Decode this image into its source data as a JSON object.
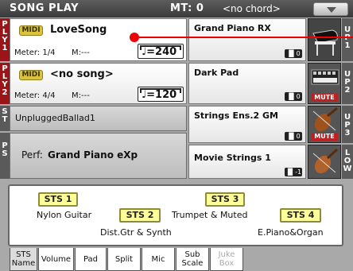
{
  "header": {
    "title": "SONG PLAY",
    "mt": "MT: 0",
    "chord": "<no chord>",
    "dropdown_icon": "triangle-down-icon"
  },
  "players": [
    {
      "tab": [
        "P",
        "L",
        "Y",
        "1"
      ],
      "midi": "MIDI",
      "song": "LoveSong",
      "meter": "Meter: 1/4",
      "measure": "M:---",
      "tempo": "♩=240"
    },
    {
      "tab": [
        "P",
        "L",
        "Y",
        "2"
      ],
      "midi": "MIDI",
      "song": "<no song>",
      "meter": "Meter: 4/4",
      "measure": "M:---",
      "tempo": "♩=120"
    }
  ],
  "st": {
    "tab": [
      "S",
      "T"
    ],
    "label": "UnpluggedBallad1"
  },
  "ps": {
    "tab": [
      "P",
      "S"
    ],
    "label": "Perf:",
    "perf": "Grand Piano eXp"
  },
  "sounds": [
    {
      "name": "Grand Piano RX",
      "badge": "▐▌0",
      "icon": "grand-piano-icon",
      "muted": false,
      "side": [
        "U",
        "P",
        "1"
      ]
    },
    {
      "name": "Dark Pad",
      "badge": "▐▌0",
      "icon": "synth-keyboard-icon",
      "muted": true,
      "mute_label": "MUTE",
      "side": [
        "U",
        "P",
        "2"
      ]
    },
    {
      "name": "Strings Ens.2 GM",
      "badge": "▐▌0",
      "icon": "violin-icon",
      "muted": true,
      "mute_label": "MUTE",
      "side": [
        "U",
        "P",
        "3"
      ]
    },
    {
      "name": "Movie Strings 1",
      "badge": "▐▌-1",
      "icon": "violin-icon",
      "muted": false,
      "side": [
        "L",
        "O",
        "W"
      ]
    }
  ],
  "sts": {
    "buttons": [
      "STS 1",
      "STS 2",
      "STS 3",
      "STS 4"
    ],
    "names": [
      "Nylon Guitar",
      "Dist.Gtr & Synth",
      "Trumpet & Muted",
      "E.Piano&Organ"
    ]
  },
  "tabs": [
    {
      "label": "STS\nName",
      "active": true,
      "disabled": false
    },
    {
      "label": "Volume",
      "active": false,
      "disabled": false
    },
    {
      "label": "Pad",
      "active": false,
      "disabled": false
    },
    {
      "label": "Split",
      "active": false,
      "disabled": false
    },
    {
      "label": "Mic",
      "active": false,
      "disabled": false
    },
    {
      "label": "Sub\nScale",
      "active": false,
      "disabled": false
    },
    {
      "label": "Juke\nBox",
      "active": false,
      "disabled": true
    }
  ],
  "colors": {
    "accent_red": "#9a1418",
    "sts_yellow": "#ffff99",
    "midi_gold": "#d9c23d"
  }
}
